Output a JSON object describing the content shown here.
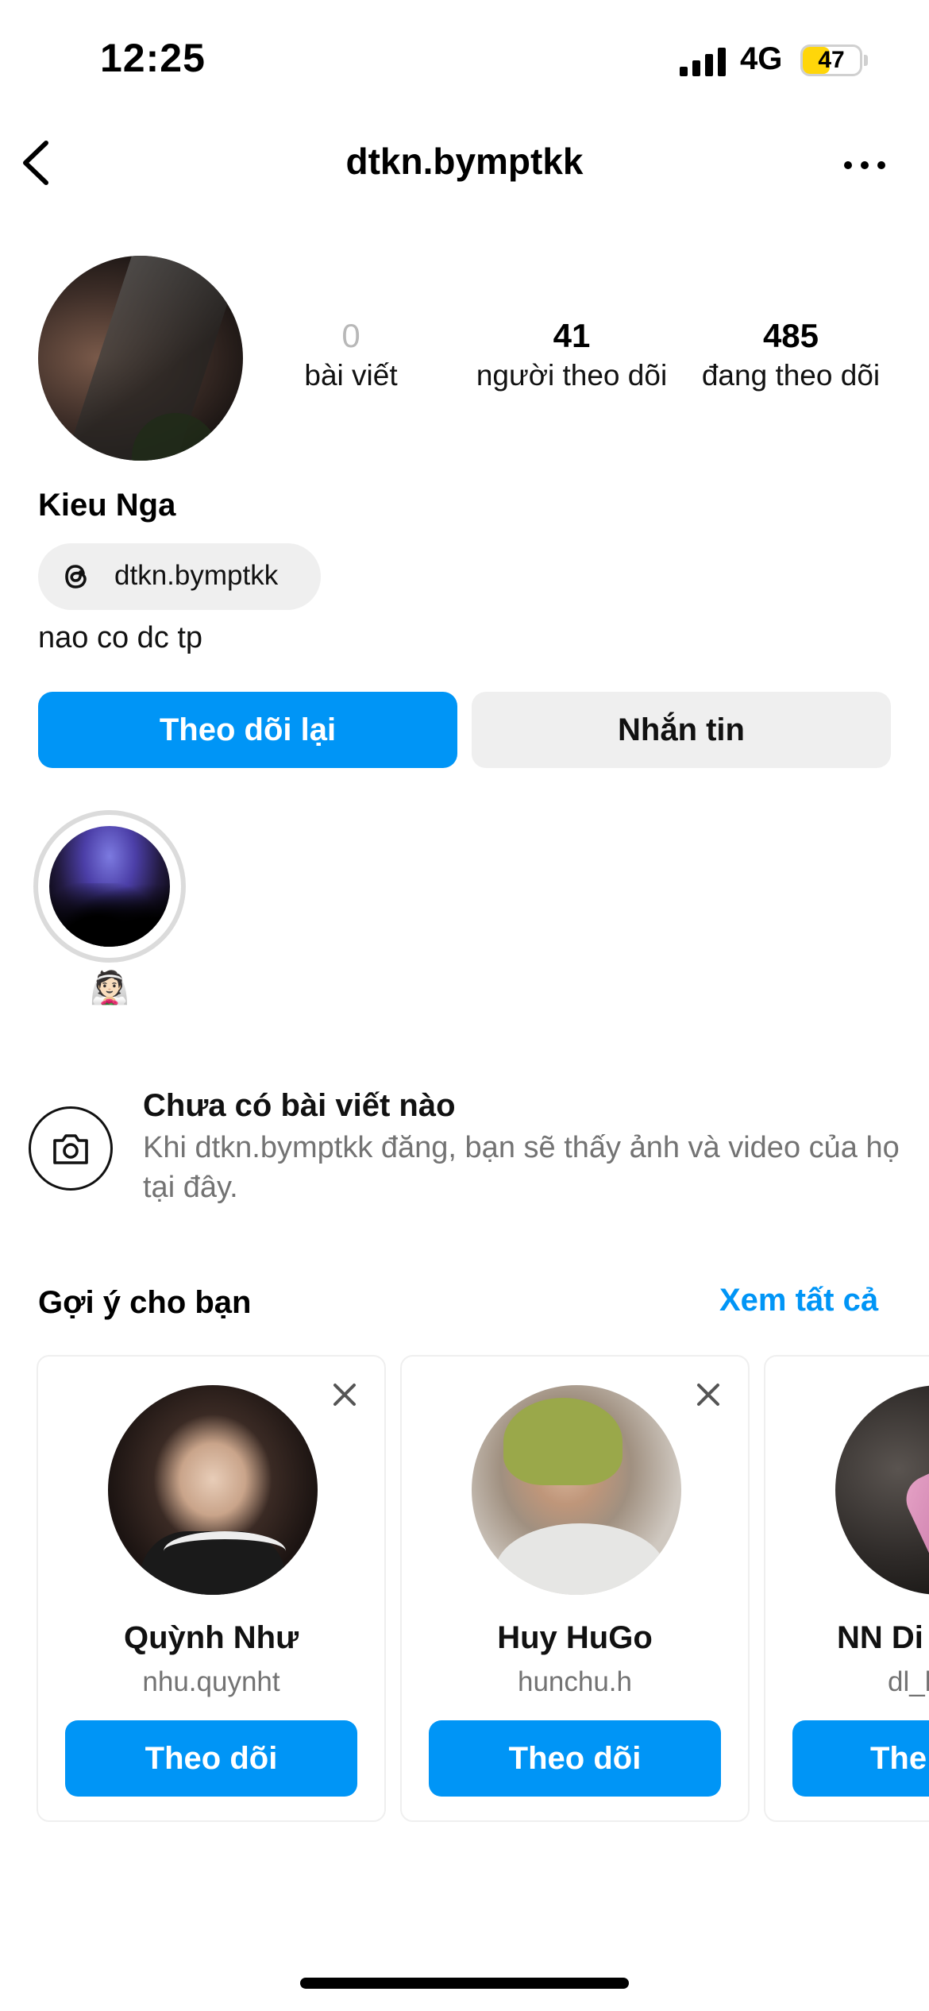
{
  "status_bar": {
    "time": "12:25",
    "network": "4G",
    "battery": "47",
    "battery_level": 0.47
  },
  "nav": {
    "username": "dtkn.bymptkk"
  },
  "profile": {
    "stats": [
      {
        "value": "0",
        "label": "bài viết"
      },
      {
        "value": "41",
        "label": "người theo dõi"
      },
      {
        "value": "485",
        "label": "đang theo dõi"
      }
    ],
    "display_name": "Kieu Nga",
    "threads_handle": "dtkn.bymptkk",
    "bio": "nao co dc tp",
    "follow_back_label": "Theo dõi lại",
    "message_label": "Nhắn tin"
  },
  "highlights": [
    {
      "label": "👰🏻"
    }
  ],
  "no_posts": {
    "title": "Chưa có bài viết nào",
    "description": "Khi dtkn.bymptkk đăng, bạn sẽ thấy ảnh và video của họ tại đây."
  },
  "suggestions": {
    "title": "Gợi ý cho bạn",
    "see_all": "Xem tất cả",
    "cards": [
      {
        "name": "Quỳnh Như",
        "handle": "nhu.quynht",
        "button": "Theo dõi"
      },
      {
        "name": "Huy HuGo",
        "handle": "hunchu.h",
        "button": "Theo dõi"
      },
      {
        "name": "NN Di",
        "handle": "dl_l",
        "button": "The"
      }
    ]
  },
  "colors": {
    "accent": "#0095f6",
    "muted_text": "#737373",
    "button_gray": "#efefef",
    "battery": "#ffd60a"
  }
}
